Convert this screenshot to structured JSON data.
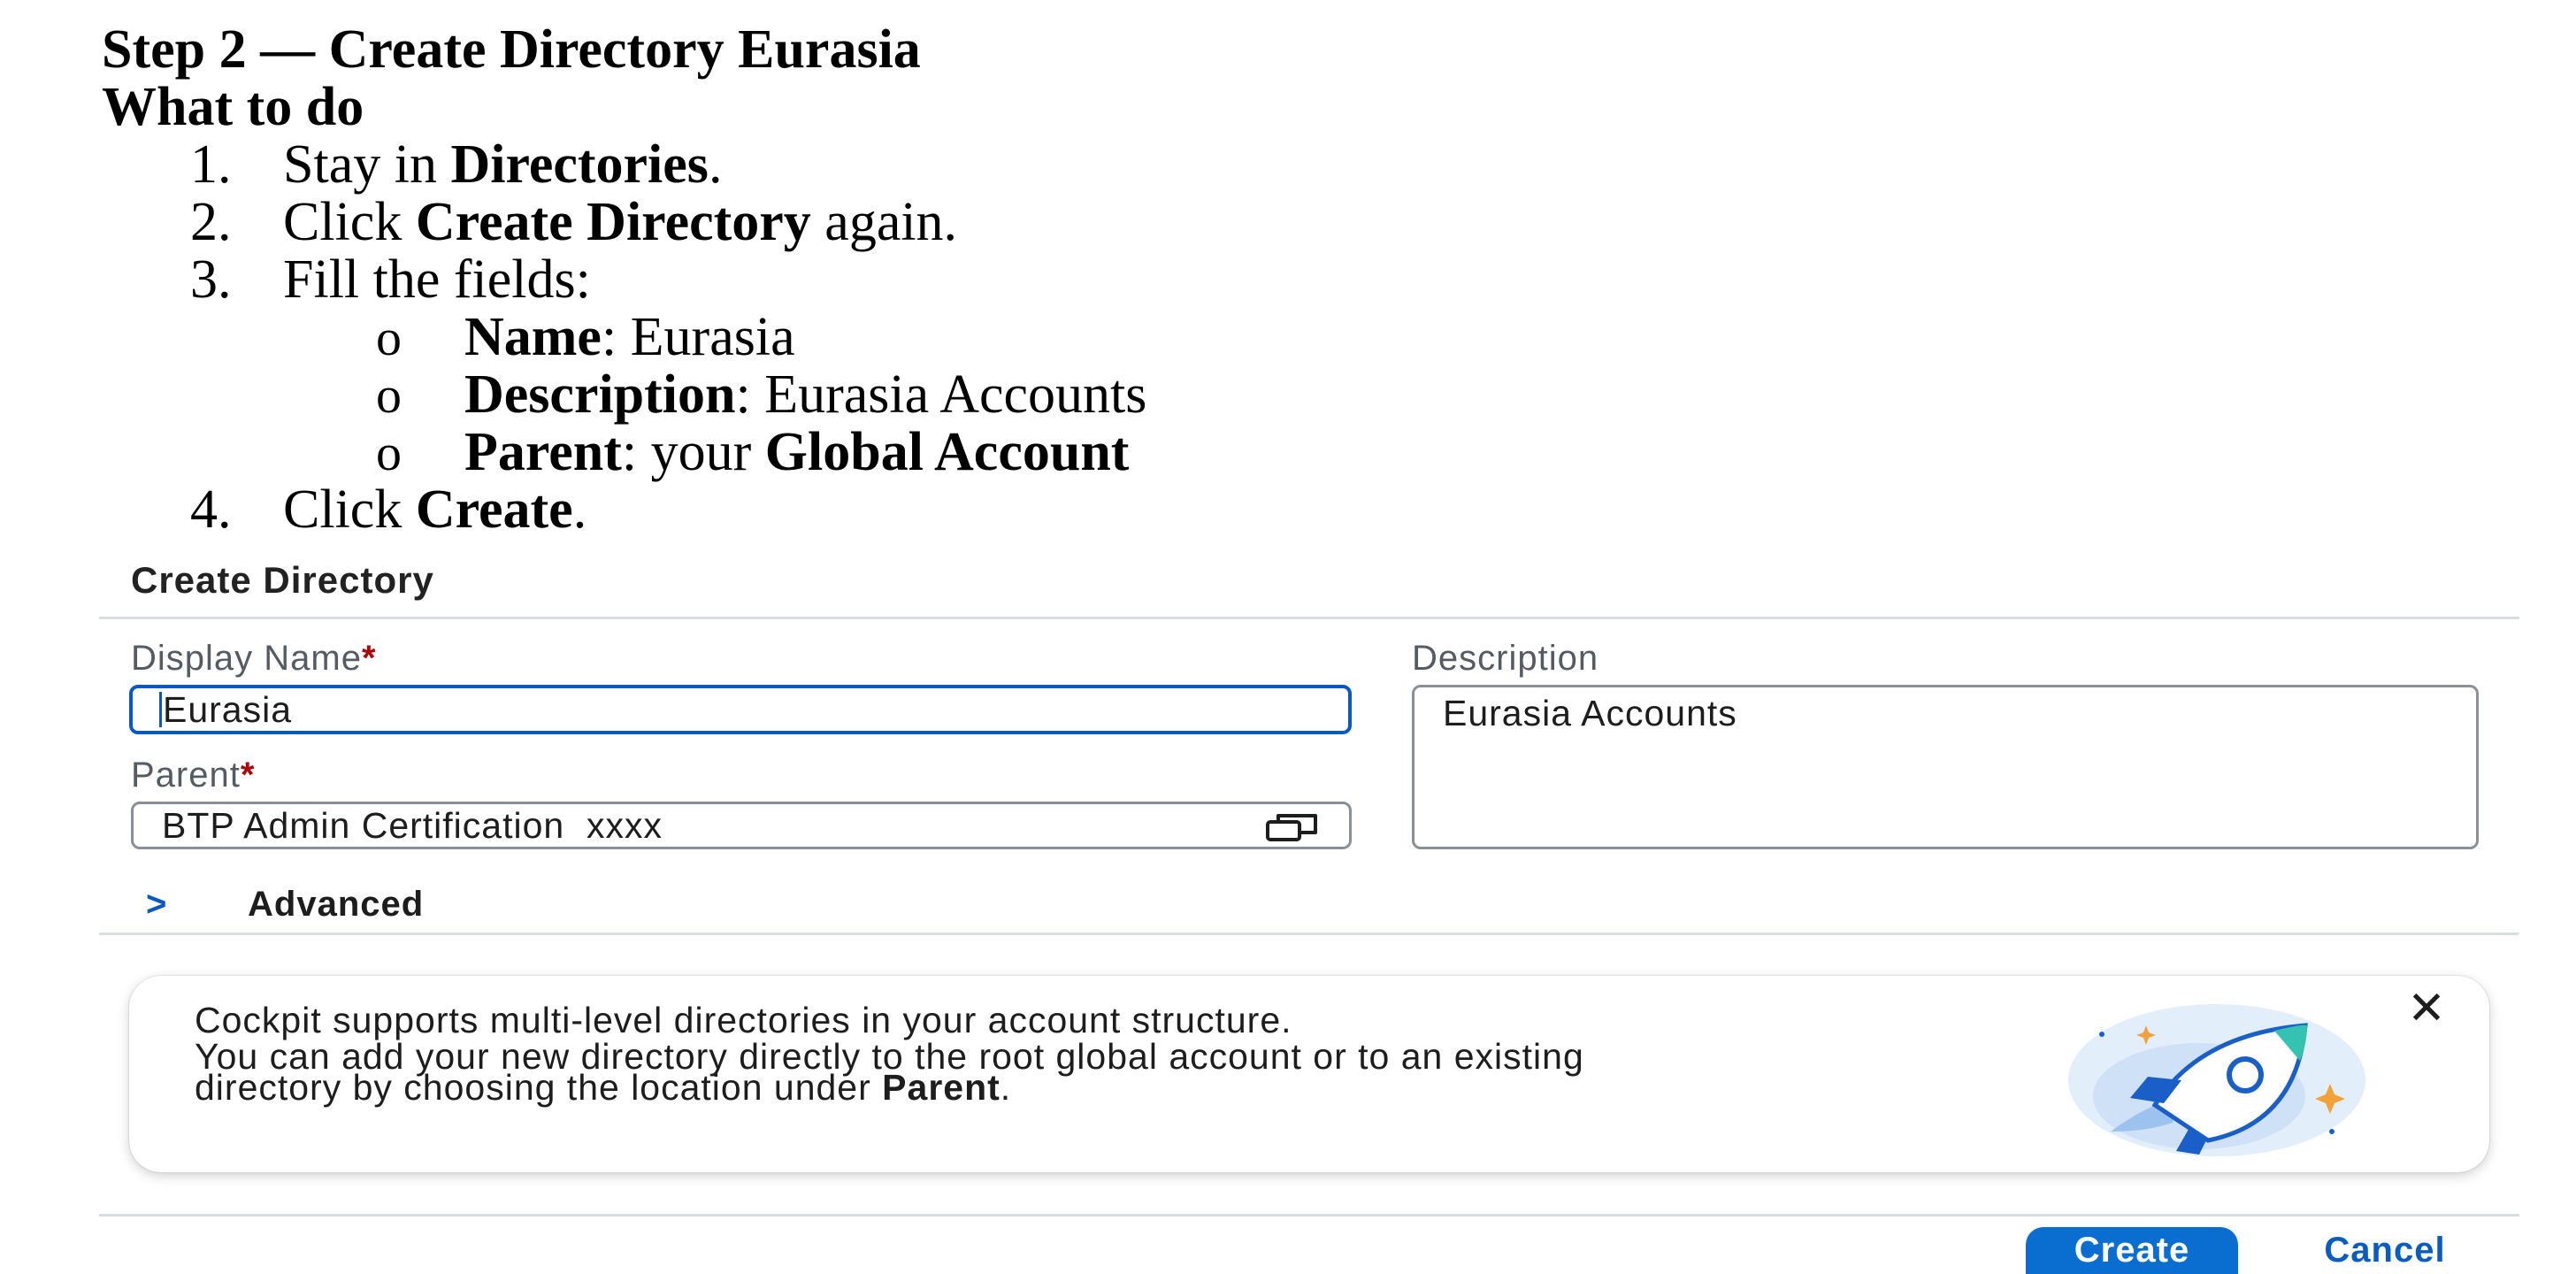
{
  "instructions": {
    "title": "Step 2 — Create Directory Eurasia",
    "subtitle": "What to do",
    "steps": [
      {
        "num": "1.",
        "pre": "Stay in ",
        "bold": "Directories",
        "post": "."
      },
      {
        "num": "2.",
        "pre": "Click ",
        "bold": "Create Directory",
        "post": " again."
      },
      {
        "num": "3.",
        "text": "Fill the fields:"
      },
      {
        "num": "4.",
        "pre": "Click ",
        "bold": "Create",
        "post": "."
      }
    ],
    "sub_bullet": "o",
    "fields_list": [
      {
        "key": "Name",
        "value": ": Eurasia"
      },
      {
        "key": "Description",
        "value": ": Eurasia Accounts"
      },
      {
        "key": "Parent",
        "value": ": your ",
        "value_bold": "Global Account"
      }
    ]
  },
  "dialog": {
    "title": "Create Directory",
    "display_name_label": "Display Name",
    "display_name_value": "Eurasia",
    "required_marker": "*",
    "parent_label": "Parent",
    "parent_value": "BTP Admin Certification  xxxx",
    "parent_icon": "value-help-icon",
    "description_label": "Description",
    "description_value": "Eurasia Accounts",
    "advanced_chevron": ">",
    "advanced_label": "Advanced",
    "accent_color": "#0a6ed1",
    "required_color": "#aa0808"
  },
  "info": {
    "line1": "Cockpit supports multi-level directories in your account structure.",
    "line2": "You can add your new directory directly to the root global account or to an existing",
    "line3_pre": "directory by choosing the location under ",
    "line3_bold": "Parent",
    "line3_post": ".",
    "close_glyph": "✕",
    "illustration": "rocket-illustration"
  },
  "footer": {
    "create_label": "Create",
    "cancel_label": "Cancel"
  }
}
